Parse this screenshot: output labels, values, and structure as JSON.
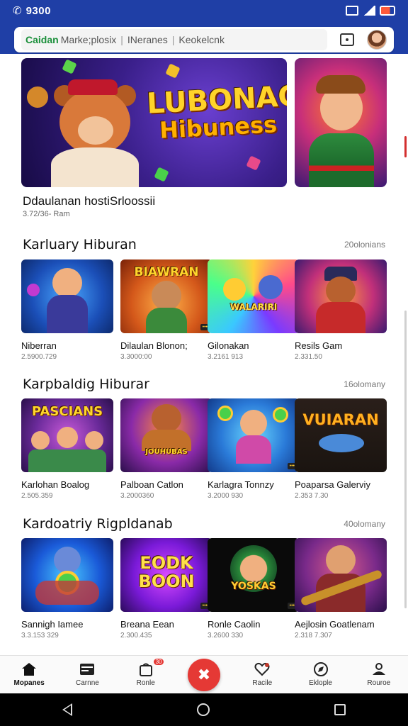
{
  "status_bar": {
    "time": "9300"
  },
  "search": {
    "brand": "Caidan",
    "segment1": "Marke;plosix",
    "segment2": "INeranes",
    "segment3": "Keokelcnk",
    "separator": "|"
  },
  "hero": {
    "art_title_line1": "LUBONAG",
    "art_title_line2": "Hibuness",
    "caption": "Ddaulanan hostiSrloossii",
    "sub": "3.72/36- Ram"
  },
  "sections": [
    {
      "title": "Karluary Hiburan",
      "more": "20olonians",
      "items": [
        {
          "title": "Niberran",
          "meta": "2.5900.729",
          "art": ""
        },
        {
          "title": "Dilaulan Blonon;",
          "meta": "3.3000:00",
          "art": "BIAWRAN"
        },
        {
          "title": "Gilonakan",
          "meta": "3.2161 913",
          "art": "WALARIRI"
        },
        {
          "title": "Resils Gam",
          "meta": "2.331.50",
          "art": ""
        }
      ]
    },
    {
      "title": "Karpbaldig Hiburar",
      "more": "16olomany",
      "items": [
        {
          "title": "Karlohan Boalog",
          "meta": "2.505.359",
          "art": "PASCIANS"
        },
        {
          "title": "Palboan Catlon",
          "meta": "3.2000360",
          "art": "JOUHUBAS"
        },
        {
          "title": "Karlagra Tonnzy",
          "meta": "3.2000 930",
          "art": ""
        },
        {
          "title": "Poaparsa Galerviy",
          "meta": "2.353 7.30",
          "art": "VUIARAN"
        }
      ]
    },
    {
      "title": "Kardoatriy Rigpldanab",
      "more": "40olomany",
      "items": [
        {
          "title": "Sannigh Iamee",
          "meta": "3.3.153 329",
          "art": ""
        },
        {
          "title": "Breana Eean",
          "meta": "2.300.435",
          "art": "EODK BOON"
        },
        {
          "title": "Ronle Caolin",
          "meta": "3.2600 330",
          "art": "YOSKAS"
        },
        {
          "title": "Aejlosin Goatlenam",
          "meta": "2.318 7.307",
          "art": ""
        }
      ]
    }
  ],
  "bottom_nav": [
    {
      "label": "Mopanes",
      "icon": "home-icon"
    },
    {
      "label": "Carnne",
      "icon": "wallet-icon"
    },
    {
      "label": "Ronle",
      "icon": "bag-icon",
      "badge": "30"
    },
    {
      "label": "",
      "icon": "play-center-icon"
    },
    {
      "label": "Racile",
      "icon": "heart-icon"
    },
    {
      "label": "Eklople",
      "icon": "explore-icon"
    },
    {
      "label": "Rouroe",
      "icon": "profile-icon"
    }
  ]
}
